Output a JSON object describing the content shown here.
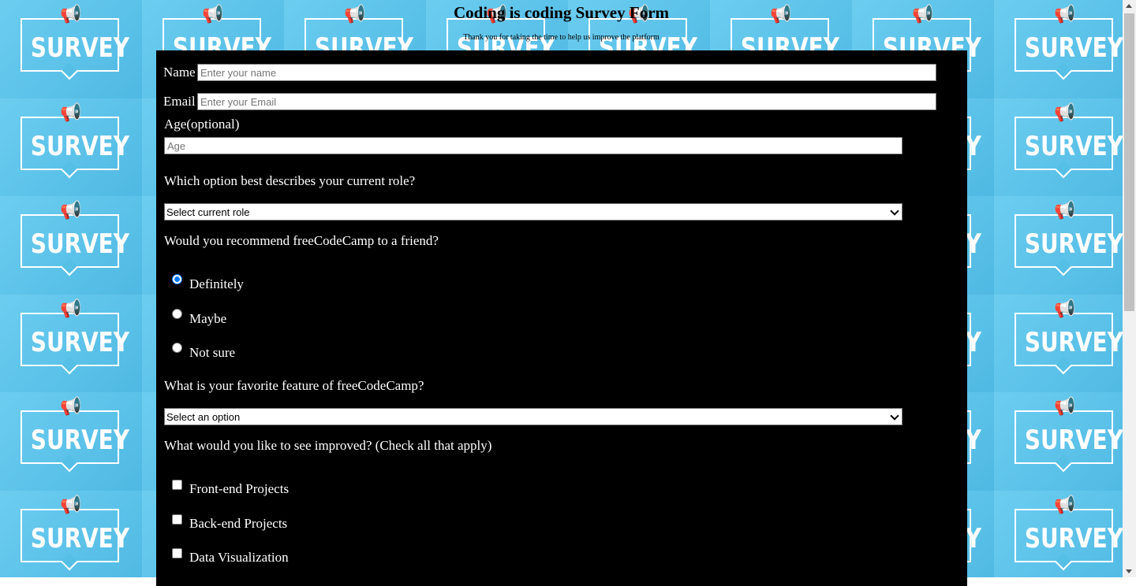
{
  "background": {
    "tile_word": "SURVEY",
    "tile_icon": "megaphone-icon",
    "colors": {
      "sky": "#5cc3e8",
      "megaphone": "#d0262b"
    }
  },
  "header": {
    "title": "Coding is coding Survey Form",
    "subtitle": "Thank you for taking the time to help us improve the platform"
  },
  "form": {
    "name": {
      "label": "Name",
      "placeholder": "Enter your name"
    },
    "email": {
      "label": "Email",
      "placeholder": "Enter your Email"
    },
    "age": {
      "label": "Age(optional)",
      "placeholder": "Age"
    },
    "role": {
      "question": "Which option best describes your current role?",
      "selected": "Select current role"
    },
    "recommend": {
      "question": "Would you recommend freeCodeCamp to a friend?",
      "options": [
        "Definitely",
        "Maybe",
        "Not sure"
      ],
      "selected": "Definitely"
    },
    "feature": {
      "question": "What is your favorite feature of freeCodeCamp?",
      "selected": "Select an option"
    },
    "improve": {
      "question": "What would you like to see improved? (Check all that apply)",
      "options": [
        "Front-end Projects",
        "Back-end Projects",
        "Data Visualization"
      ]
    }
  },
  "colors": {
    "panel": "#000000",
    "accent": "#0075ff"
  }
}
